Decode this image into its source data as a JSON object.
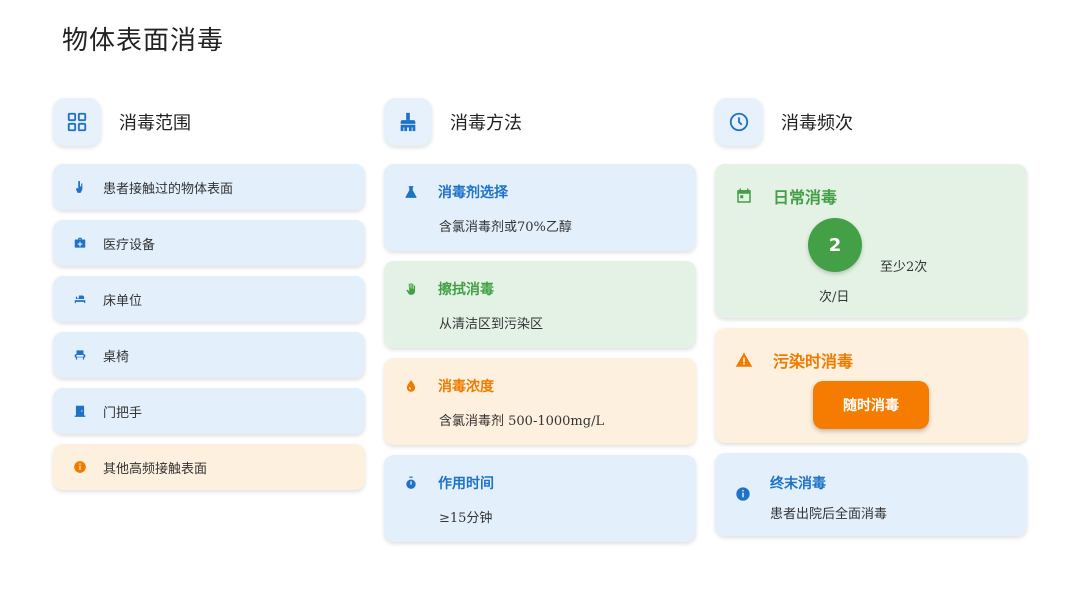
{
  "page": {
    "title": "物体表面消毒"
  },
  "scope": {
    "label": "消毒范围",
    "icon": "grid-icon",
    "items": [
      {
        "label": "患者接触过的物体表面",
        "icon": "touch-icon",
        "tone": "blue"
      },
      {
        "label": "医疗设备",
        "icon": "medical-kit-icon",
        "tone": "blue"
      },
      {
        "label": "床单位",
        "icon": "bed-icon",
        "tone": "blue"
      },
      {
        "label": "桌椅",
        "icon": "chair-icon",
        "tone": "blue"
      },
      {
        "label": "门把手",
        "icon": "door-icon",
        "tone": "blue"
      },
      {
        "label": "其他高频接触表面",
        "icon": "info-icon",
        "tone": "orange"
      }
    ]
  },
  "method": {
    "label": "消毒方法",
    "icon": "cleaning-brush-icon",
    "cards": [
      {
        "title": "消毒剂选择",
        "desc": "含氯消毒剂或70%乙醇",
        "icon": "flask-icon",
        "tone": "blue"
      },
      {
        "title": "擦拭消毒",
        "desc": "从清洁区到污染区",
        "icon": "hand-icon",
        "tone": "green"
      },
      {
        "title": "消毒浓度",
        "desc": "含氯消毒剂 500-1000mg/L",
        "icon": "drop-icon",
        "tone": "orange"
      },
      {
        "title": "作用时间",
        "desc": "≥15分钟",
        "icon": "timer-icon",
        "tone": "blue"
      }
    ]
  },
  "frequency": {
    "label": "消毒频次",
    "icon": "clock-icon",
    "daily": {
      "title": "日常消毒",
      "icon": "calendar-icon",
      "count": "2",
      "note": "至少2次",
      "unit": "次/日"
    },
    "contamination": {
      "title": "污染时消毒",
      "icon": "warning-icon",
      "button": "随时消毒"
    },
    "terminal": {
      "title": "终末消毒",
      "icon": "info-icon",
      "desc": "患者出院后全面消毒"
    }
  },
  "colors": {
    "blue": "#1e73c8",
    "green": "#43a047",
    "orange": "#ef7c00"
  }
}
